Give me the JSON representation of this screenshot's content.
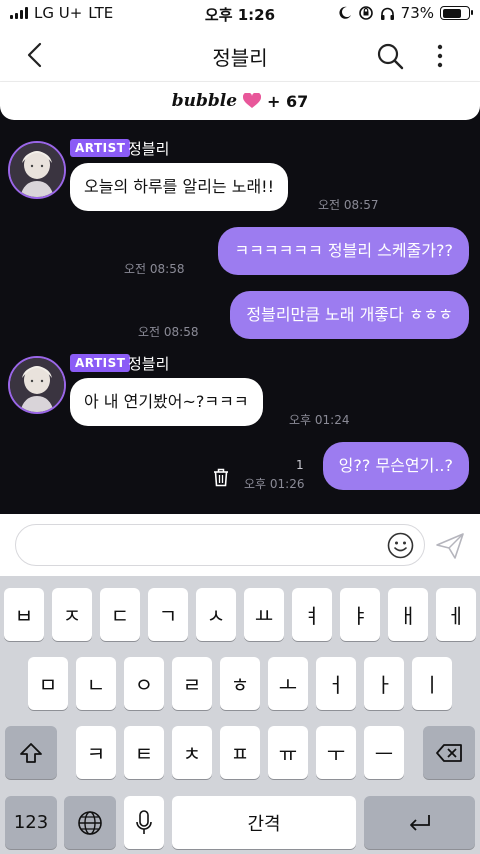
{
  "status_bar": {
    "carrier": "LG U+",
    "network": "LTE",
    "time": "오후 1:26",
    "battery": "73%",
    "battery_level": 0.73
  },
  "header": {
    "title": "정블리",
    "back_icon": "chevron-left-icon",
    "search_icon": "search-icon",
    "more_icon": "more-vertical-icon"
  },
  "bubble_bar": {
    "logo": "bubble",
    "count": "+ 67",
    "heart_color": "#e8579a"
  },
  "colors": {
    "chat_bg": "#0d0d12",
    "badge": "#8b5cf6",
    "outgoing": "#9c7cf0"
  },
  "chat": {
    "artist_badge": "ARTIST",
    "artist_name": "정블리",
    "messages": [
      {
        "dir": "in",
        "text": "오늘의 하루를 알리는 노래!!",
        "time": "오전 08:57"
      },
      {
        "dir": "out",
        "text": "ㅋㅋㅋㅋㅋㅋ 정블리 스케줄가??",
        "time": "오전 08:58"
      },
      {
        "dir": "out",
        "text": "정블리만큼 노래 개좋다 ㅎㅎㅎ",
        "time": "오전 08:58"
      },
      {
        "dir": "in",
        "text": "아 내 연기봤어~?ㅋㅋㅋ",
        "time": "오후 01:24"
      },
      {
        "dir": "out",
        "text": "잉?? 무슨연기..?",
        "time": "오후 01:26",
        "unread": "1"
      }
    ]
  },
  "input": {
    "value": "",
    "emoji_icon": "smiley-icon",
    "send_icon": "send-icon"
  },
  "keyboard": {
    "row1": [
      "ㅂ",
      "ㅈ",
      "ㄷ",
      "ㄱ",
      "ㅅ",
      "ㅛ",
      "ㅕ",
      "ㅑ",
      "ㅐ",
      "ㅔ"
    ],
    "row2": [
      "ㅁ",
      "ㄴ",
      "ㅇ",
      "ㄹ",
      "ㅎ",
      "ㅗ",
      "ㅓ",
      "ㅏ",
      "ㅣ"
    ],
    "row3": [
      "ㅋ",
      "ㅌ",
      "ㅊ",
      "ㅍ",
      "ㅠ",
      "ㅜ",
      "ㅡ"
    ],
    "numbers": "123",
    "space": "간격",
    "shift_icon": "shift-icon",
    "delete_icon": "backspace-icon",
    "globe_icon": "globe-icon",
    "mic_icon": "microphone-icon",
    "return_icon": "return-icon"
  }
}
